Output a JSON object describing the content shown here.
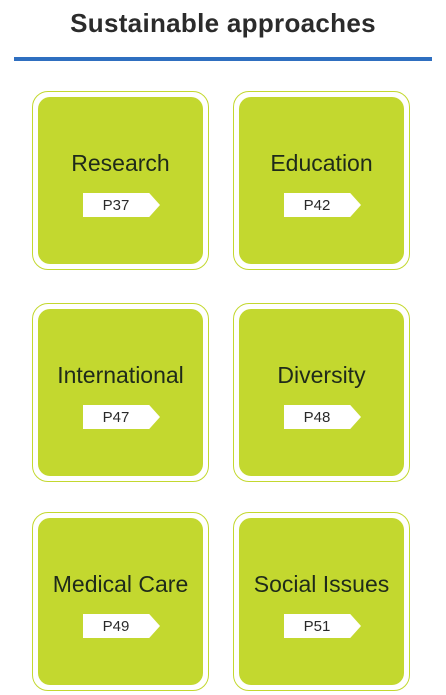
{
  "header": {
    "title": "Sustainable approaches"
  },
  "theme": {
    "accent": "#c3d82f",
    "rule": "#2f6fc0"
  },
  "cards": [
    {
      "label": "Research",
      "page": "P37"
    },
    {
      "label": "Education",
      "page": "P42"
    },
    {
      "label": "International",
      "page": "P47"
    },
    {
      "label": "Diversity",
      "page": "P48"
    },
    {
      "label": "Medical Care",
      "page": "P49"
    },
    {
      "label": "Social Issues",
      "page": "P51"
    }
  ]
}
